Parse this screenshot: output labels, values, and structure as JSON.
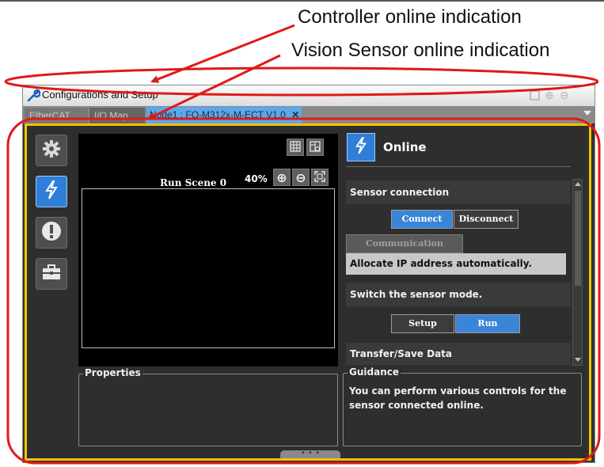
{
  "callouts": {
    "controller": "Controller online indication",
    "vision": "Vision Sensor online indication"
  },
  "window": {
    "title": "Configurations and Setup"
  },
  "tabs": [
    {
      "label": "EtherCAT",
      "active": false
    },
    {
      "label": "I/O Map",
      "active": false
    },
    {
      "label": "Node1 : FQ-M312x-M-ECT V1.0",
      "active": true,
      "close": "✕"
    }
  ],
  "viewer": {
    "scene_label": "Run Scene 0",
    "zoom": "40%"
  },
  "properties": {
    "label": "Properties"
  },
  "online_panel": {
    "title": "Online",
    "sensor_connection": {
      "header": "Sensor connection",
      "connect": "Connect",
      "disconnect": "Disconnect",
      "comm_settings": "Communication settings",
      "ip_text": "Allocate IP address automatically."
    },
    "mode": {
      "header": "Switch the sensor mode.",
      "setup": "Setup",
      "run": "Run"
    },
    "transfer": {
      "header": "Transfer/Save Data"
    },
    "guidance": {
      "label": "Guidance",
      "text": "You can perform various controls for the sensor connected online."
    }
  },
  "colors": {
    "annotation": "#e01919",
    "online_bar": "#f2c200",
    "accent": "#3a85d8"
  },
  "icons": [
    "wrench-icon",
    "gear-icon",
    "lightning-icon",
    "alert-icon",
    "toolbox-icon",
    "grid-icon",
    "fit-icon",
    "zoom-in-icon",
    "zoom-out-icon",
    "fullscreen-icon"
  ]
}
